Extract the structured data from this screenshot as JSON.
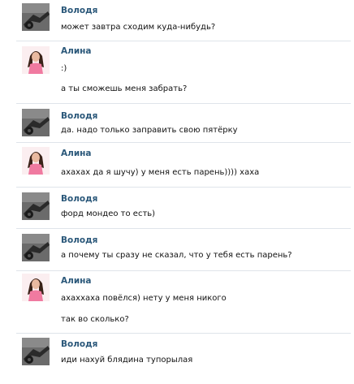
{
  "colors": {
    "name": "#2b587a",
    "text": "#111111",
    "separator": "#dfe4ea"
  },
  "messages": [
    {
      "author": "Володя",
      "lines": [
        "может завтра сходим куда-нибудь?"
      ]
    },
    {
      "author": "Алина",
      "lines": [
        ":)",
        "а ты сможешь меня забрать?"
      ]
    },
    {
      "author": "Володя",
      "lines": [
        "да. надо только заправить свою пятёрку"
      ]
    },
    {
      "author": "Алина",
      "lines": [
        "ахахах да я шучу) у меня есть парень)))) хаха"
      ]
    },
    {
      "author": "Володя",
      "lines": [
        "форд мондео то есть)"
      ]
    },
    {
      "author": "Володя",
      "lines": [
        "а почему ты сразу не сказал, что у тебя есть парень?"
      ]
    },
    {
      "author": "Алина",
      "lines": [
        "ахаххаха повёлся) нету у меня никого",
        "так во сколько?"
      ]
    },
    {
      "author": "Володя",
      "lines": [
        "иди нахуй блядина тупорылая"
      ]
    }
  ]
}
